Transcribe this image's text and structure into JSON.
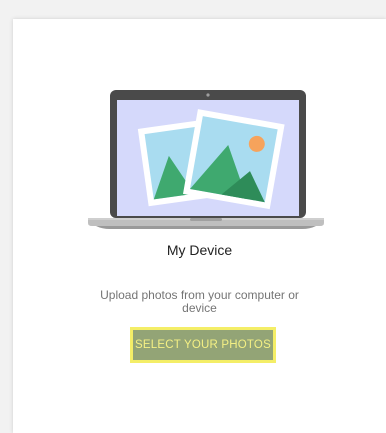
{
  "source_card": {
    "title": "My Device",
    "description": "Upload photos from your computer or device",
    "select_button_label": "SELECT YOUR PHOTOS"
  },
  "icons": {
    "illustration": "laptop-photos-icon"
  },
  "colors": {
    "button_bg": "#93a476",
    "button_border": "#f4ee67",
    "button_text": "#f4f084",
    "screen_bg": "#d5d9fb",
    "mountain_green": "#3fa96f",
    "sun_orange": "#f6a35c"
  }
}
